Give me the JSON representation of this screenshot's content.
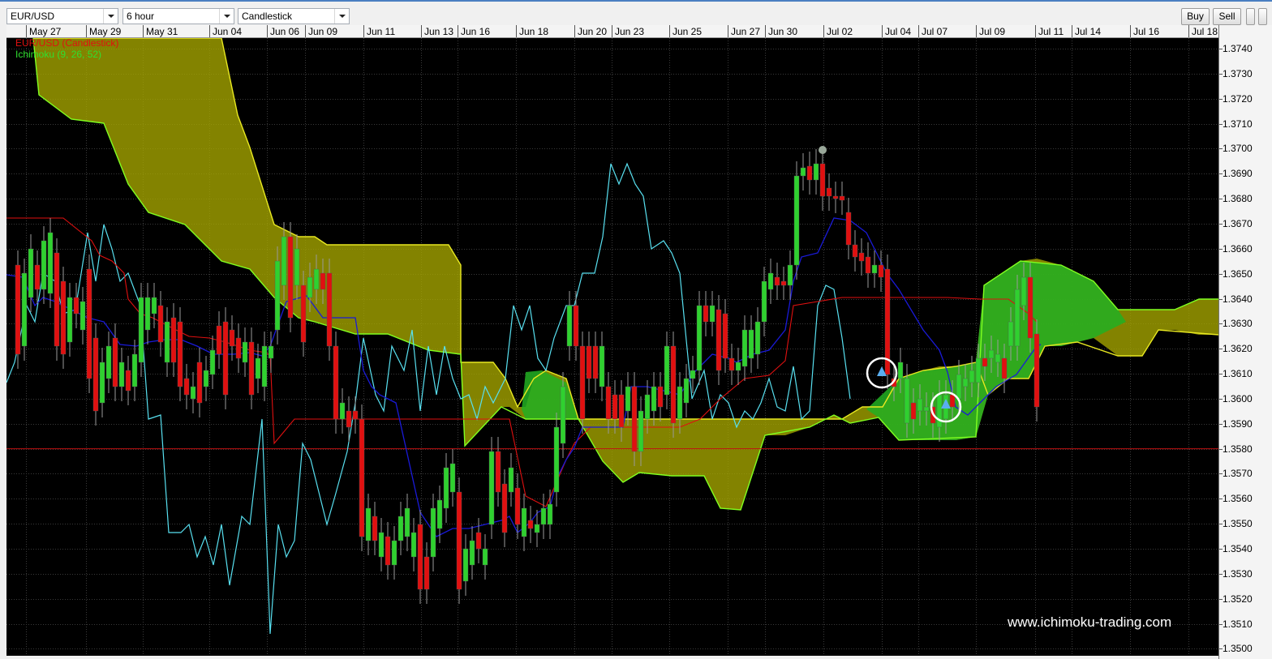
{
  "toolbar": {
    "symbol": "EUR/USD",
    "timeframe": "6 hour",
    "chart_type": "Candlestick",
    "buy_label": "Buy",
    "sell_label": "Sell"
  },
  "chart": {
    "legend_main": "EUR/USD (Candlestick)",
    "legend_indicator": "Ichimoku (9, 26, 52)",
    "watermark": "www.ichimoku-trading.com",
    "date_ticks": [
      "May 27",
      "May 29",
      "May 31",
      "Jun 04",
      "Jun 06",
      "Jun 09",
      "Jun 11",
      "Jun 13",
      "Jun 16",
      "Jun 18",
      "Jun 20",
      "Jun 23",
      "Jun 25",
      "Jun 27",
      "Jun 30",
      "Jul 02",
      "Jul 04",
      "Jul 07",
      "Jul 09",
      "Jul 11",
      "Jul 14",
      "Jul 16",
      "Jul 18"
    ],
    "price_ticks": [
      "1.3740",
      "1.3730",
      "1.3720",
      "1.3710",
      "1.3700",
      "1.3690",
      "1.3680",
      "1.3670",
      "1.3660",
      "1.3650",
      "1.3640",
      "1.3630",
      "1.3620",
      "1.3610",
      "1.3600",
      "1.3590",
      "1.3580",
      "1.3570",
      "1.3560",
      "1.3550",
      "1.3540",
      "1.3530",
      "1.3520",
      "1.3510",
      "1.3500"
    ],
    "current_price_line": 1.358,
    "colors": {
      "background": "#000000",
      "bull_candle": "#2fd12f",
      "bear_candle": "#e01010",
      "kumo_bearish": "#a8a800",
      "kumo_bullish": "#22b022",
      "tenkan": "#1a1ad8",
      "kijun": "#e01010",
      "chikou": "#58e0f0",
      "senkou_a": "#80ff20",
      "senkou_b": "#e8e820"
    }
  }
}
